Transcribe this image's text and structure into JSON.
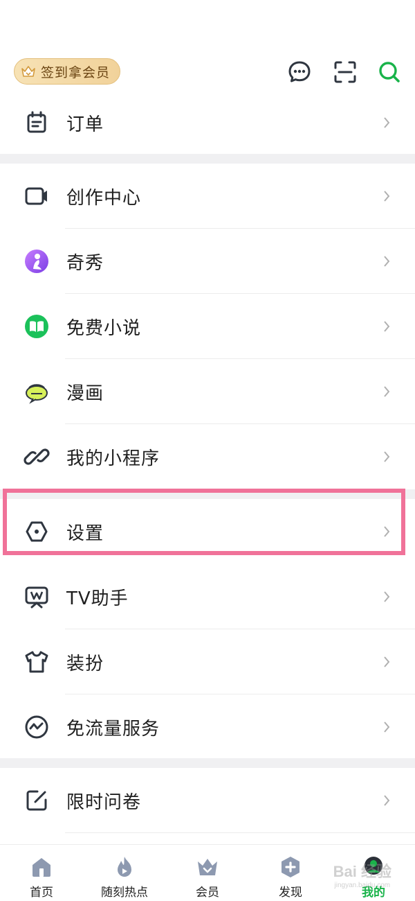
{
  "header": {
    "vip_pill_label": "签到拿会员",
    "icons": [
      "chat-bubble-icon",
      "scan-icon",
      "search-icon"
    ]
  },
  "menu_group_1": [
    {
      "label": "订单",
      "icon": "order-icon"
    }
  ],
  "menu_group_2": [
    {
      "label": "创作中心",
      "icon": "video-camera-icon"
    },
    {
      "label": "奇秀",
      "icon": "qixiu-icon"
    },
    {
      "label": "免费小说",
      "icon": "book-icon"
    },
    {
      "label": "漫画",
      "icon": "comic-icon"
    },
    {
      "label": "我的小程序",
      "icon": "link-icon"
    }
  ],
  "menu_group_3": [
    {
      "label": "设置",
      "icon": "settings-icon"
    },
    {
      "label": "TV助手",
      "icon": "tv-icon"
    },
    {
      "label": "装扮",
      "icon": "tshirt-icon"
    },
    {
      "label": "免流量服务",
      "icon": "data-flow-icon"
    }
  ],
  "menu_group_4": [
    {
      "label": "限时问卷",
      "icon": "survey-icon"
    }
  ],
  "tabbar": {
    "tabs": [
      {
        "label": "首页",
        "icon": "home-icon"
      },
      {
        "label": "随刻热点",
        "icon": "flame-icon"
      },
      {
        "label": "会员",
        "icon": "crown-icon"
      },
      {
        "label": "发现",
        "icon": "discover-icon"
      },
      {
        "label": "我的",
        "icon": "avatar-icon",
        "active": true
      }
    ]
  },
  "watermark": {
    "text": "Bai 经验",
    "subtext": "jingyan.baidu.com"
  },
  "colors": {
    "accent_green": "#19b34a",
    "highlight_pink": "#f07299",
    "icon_gray": "#2f3640",
    "tab_icon_gray": "#8d99b0",
    "vip_gold": "#f1d29a"
  }
}
